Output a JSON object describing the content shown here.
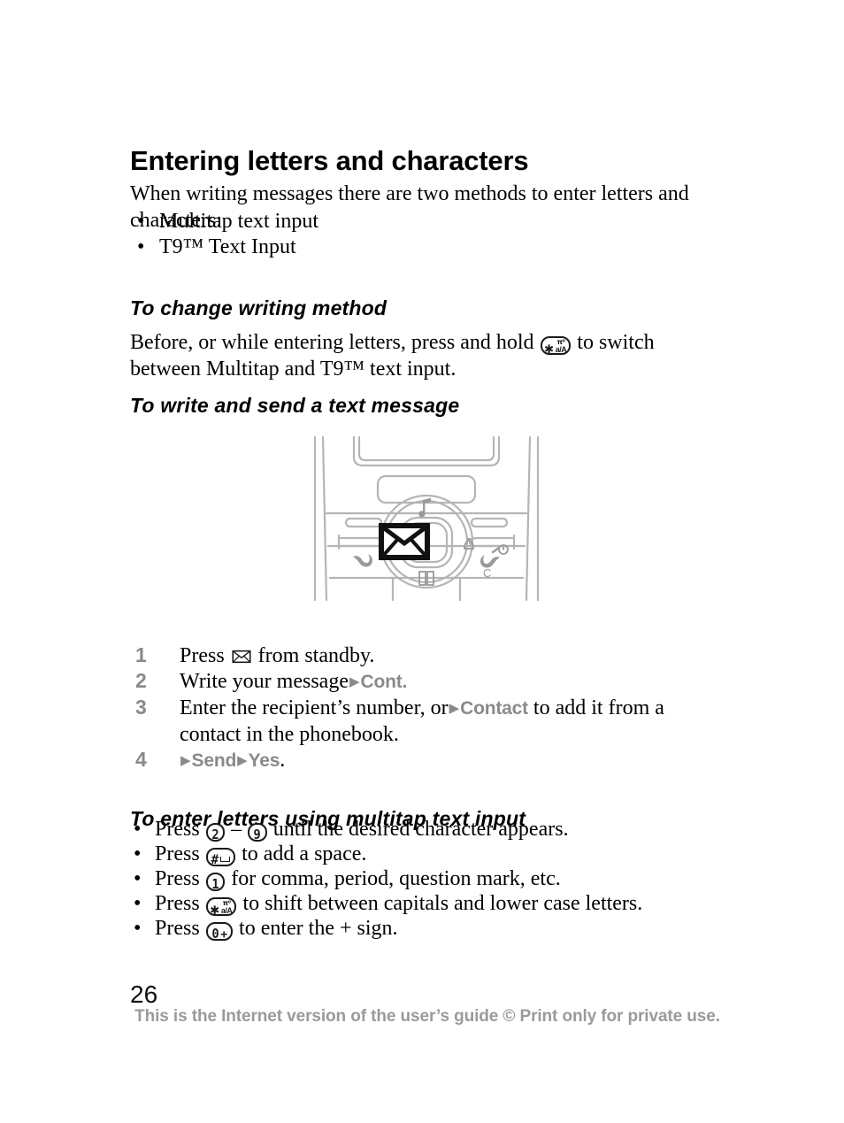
{
  "document": {
    "page_number": "26",
    "footer_note": "This is the Internet version of the user’s guide © Print only for private use."
  },
  "colors": {
    "text": "#000000",
    "menu_grey": "#8a8a8a",
    "footer_grey": "#9a9a9a",
    "diagram_line": "#b3b3b3"
  },
  "sections": {
    "main_heading": "Entering letters and characters",
    "intro_paragraph": "When writing messages there are two methods to enter letters and characters:",
    "intro_bullets": [
      {
        "bullet": "•",
        "text": "Multitap text input"
      },
      {
        "bullet": "•",
        "text": "T9™ Text Input"
      }
    ],
    "change_method": {
      "heading": "To change writing method",
      "text_before_key": "Before, or while entering letters, press and hold",
      "key": {
        "primary": "✱",
        "label_top": "π⁰",
        "label_bottom": "a/A"
      },
      "text_after_key": "to switch between Multitap and T9™ text input."
    },
    "write_send": {
      "heading": "To write and send a text message",
      "steps": [
        {
          "number": "1",
          "parts": [
            {
              "type": "text",
              "value": "Press"
            },
            {
              "type": "envelope-icon"
            },
            {
              "type": "text",
              "value": "from standby."
            }
          ]
        },
        {
          "number": "2",
          "parts": [
            {
              "type": "text",
              "value": "Write your message"
            },
            {
              "type": "arrow",
              "value": "▶"
            },
            {
              "type": "menu",
              "value": "Cont."
            }
          ]
        },
        {
          "number": "3",
          "parts": [
            {
              "type": "text",
              "value": "Enter the recipient’s number, or"
            },
            {
              "type": "arrow",
              "value": "▶"
            },
            {
              "type": "menu",
              "value": "Contact"
            },
            {
              "type": "text",
              "value": "to add it from a contact in the phonebook."
            }
          ]
        },
        {
          "number": "4",
          "parts": [
            {
              "type": "arrow",
              "value": "▶"
            },
            {
              "type": "menu",
              "value": "Send"
            },
            {
              "type": "arrow",
              "value": "▶"
            },
            {
              "type": "menu",
              "value": "Yes"
            },
            {
              "type": "text",
              "value": "."
            }
          ]
        }
      ]
    },
    "multitap": {
      "heading": "To enter letters using multitap text input",
      "bullets": [
        {
          "bullet": "•",
          "prefix": "Press",
          "keys": [
            "2",
            "9"
          ],
          "separator": "–",
          "suffix": "until the desired character appears."
        },
        {
          "bullet": "•",
          "prefix": "Press",
          "key": "#",
          "key_extra": "space-mark",
          "suffix": "to add a space."
        },
        {
          "bullet": "•",
          "prefix": "Press",
          "key": "1",
          "suffix": "for comma, period, question mark, etc."
        },
        {
          "bullet": "•",
          "prefix": "Press",
          "key": "✱",
          "key_label_top": "π⁰",
          "key_label_bottom": "a/A",
          "suffix": "to shift between capitals and lower case letters."
        },
        {
          "bullet": "•",
          "prefix": "Press",
          "key": "0",
          "key_extra": "+",
          "suffix": "to enter the + sign."
        }
      ]
    }
  },
  "figure": {
    "name": "phone-keypad-diagram",
    "description": "Lower half of a mobile phone showing display edge, soft keys, navigation wheel and keypad top row",
    "navigation_icons": {
      "top": "music-note",
      "right": "bell",
      "bottom": "book",
      "overlay_left": "envelope"
    },
    "left_softkey_icon": "call-handset",
    "right_softkey_icon": "end-call-handset",
    "right_power_icon": "power",
    "right_clear_label": "C"
  }
}
